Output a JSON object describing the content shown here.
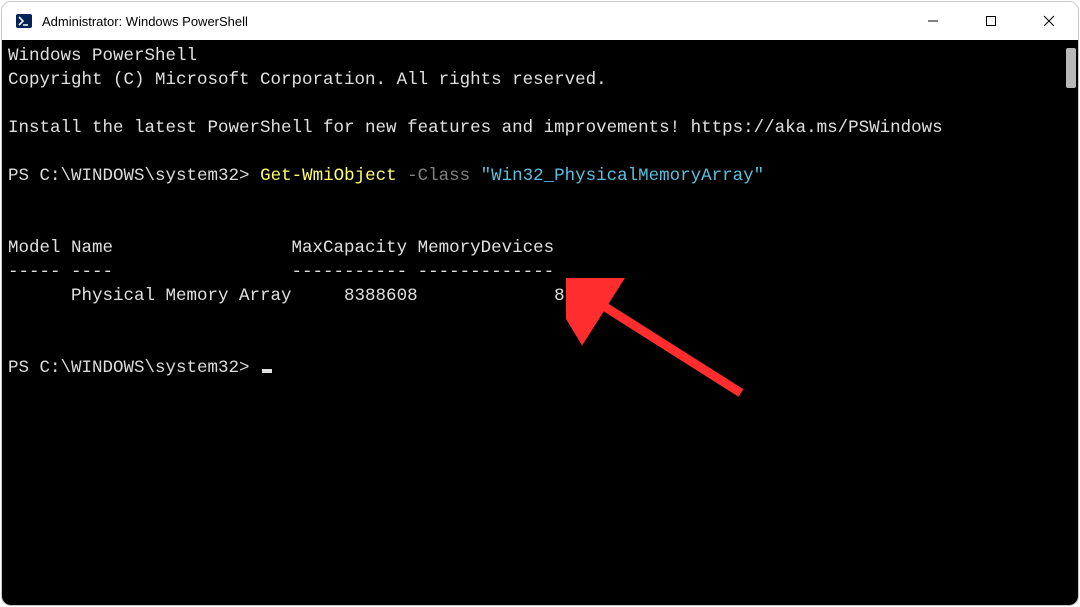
{
  "window": {
    "title": "Administrator: Windows PowerShell"
  },
  "terminal": {
    "header1": "Windows PowerShell",
    "header2": "Copyright (C) Microsoft Corporation. All rights reserved.",
    "hint": "Install the latest PowerShell for new features and improvements! https://aka.ms/PSWindows",
    "prompt": "PS C:\\WINDOWS\\system32>",
    "cmdlet": "Get-WmiObject",
    "param": "-Class",
    "quoted": "\"Win32_PhysicalMemoryArray\"",
    "table_header": "Model Name                 MaxCapacity MemoryDevices",
    "table_divider": "----- ----                 ----------- -------------",
    "table_row": "      Physical Memory Array     8388608             8"
  }
}
